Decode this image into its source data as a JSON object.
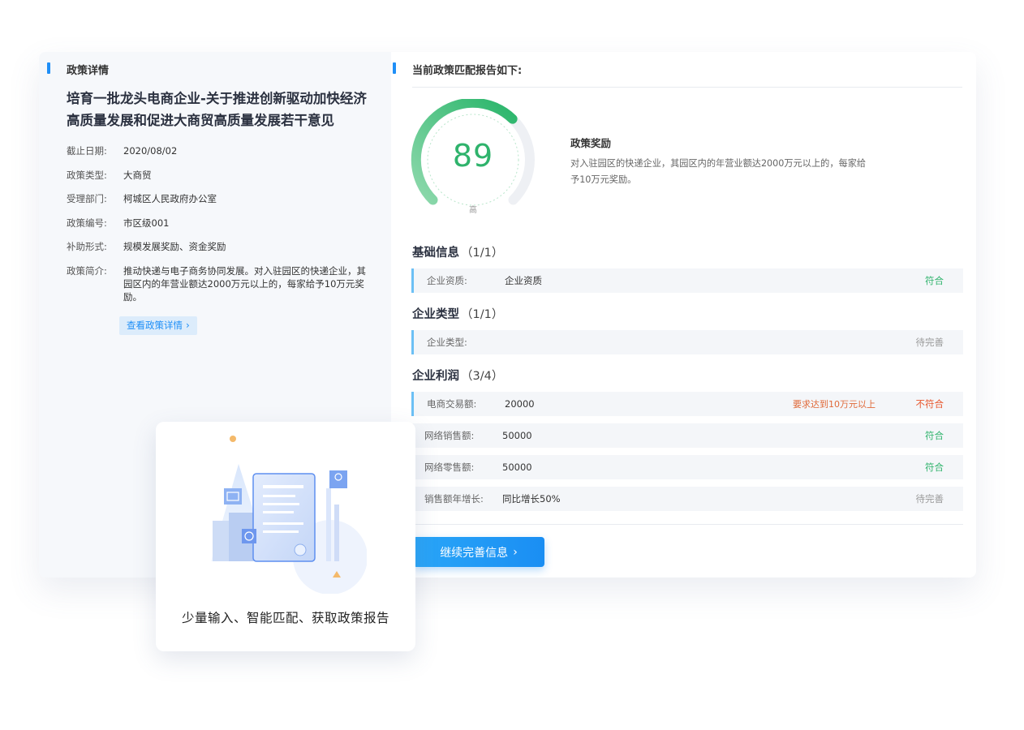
{
  "policy": {
    "section_title": "政策详情",
    "title": "培育一批龙头电商企业-关于推进创新驱动加快经济高质量发展和促进大商贸高质量发展若干意见",
    "fields": [
      {
        "key": "截止日期:",
        "value": "2020/08/02"
      },
      {
        "key": "政策类型:",
        "value": "大商贸"
      },
      {
        "key": "受理部门:",
        "value": "柯城区人民政府办公室"
      },
      {
        "key": "政策编号:",
        "value": "市区级001"
      },
      {
        "key": "补助形式:",
        "value": "规模发展奖励、资金奖励"
      },
      {
        "key": "政策简介:",
        "value": "推动快递与电子商务协同发展。对入驻园区的快递企业，其园区内的年营业额达2000万元以上的，每家给予10万元奖励。"
      }
    ],
    "detail_button": "查看政策详情"
  },
  "report": {
    "section_title": "当前政策匹配报告如下:",
    "score": "89",
    "score_fraction": 0.89,
    "level": "高",
    "reward_title": "政策奖励",
    "reward_desc": "对入驻园区的快递企业，其园区内的年营业额达2000万元以上的，每家给予10万元奖励。",
    "groups": [
      {
        "title": "基础信息",
        "count": "（1/1）",
        "rows": [
          {
            "key": "企业资质:",
            "value": "企业资质",
            "note": "",
            "status": "符合",
            "status_type": "ok"
          }
        ]
      },
      {
        "title": "企业类型",
        "count": "（1/1）",
        "rows": [
          {
            "key": "企业类型:",
            "value": "",
            "note": "",
            "status": "待完善",
            "status_type": "wait"
          }
        ]
      },
      {
        "title": "企业利润",
        "count": "（3/4）",
        "rows": [
          {
            "key": "电商交易额:",
            "value": "20000",
            "note": "要求达到10万元以上",
            "status": "不符合",
            "status_type": "bad"
          },
          {
            "key": "网络销售额:",
            "value": "50000",
            "note": "",
            "status": "符合",
            "status_type": "ok"
          },
          {
            "key": "网络零售额:",
            "value": "50000",
            "note": "",
            "status": "符合",
            "status_type": "ok"
          },
          {
            "key": "销售额年增长:",
            "value": "同比增长50%",
            "note": "",
            "status": "待完善",
            "status_type": "wait"
          }
        ]
      }
    ],
    "continue_button": "继续完善信息"
  },
  "promo": {
    "caption": "少量输入、智能匹配、获取政策报告"
  },
  "colors": {
    "accent": "#1f8ff7",
    "score_green": "#2fb36c",
    "fail_red": "#e8542a",
    "pending_gray": "#999999"
  }
}
